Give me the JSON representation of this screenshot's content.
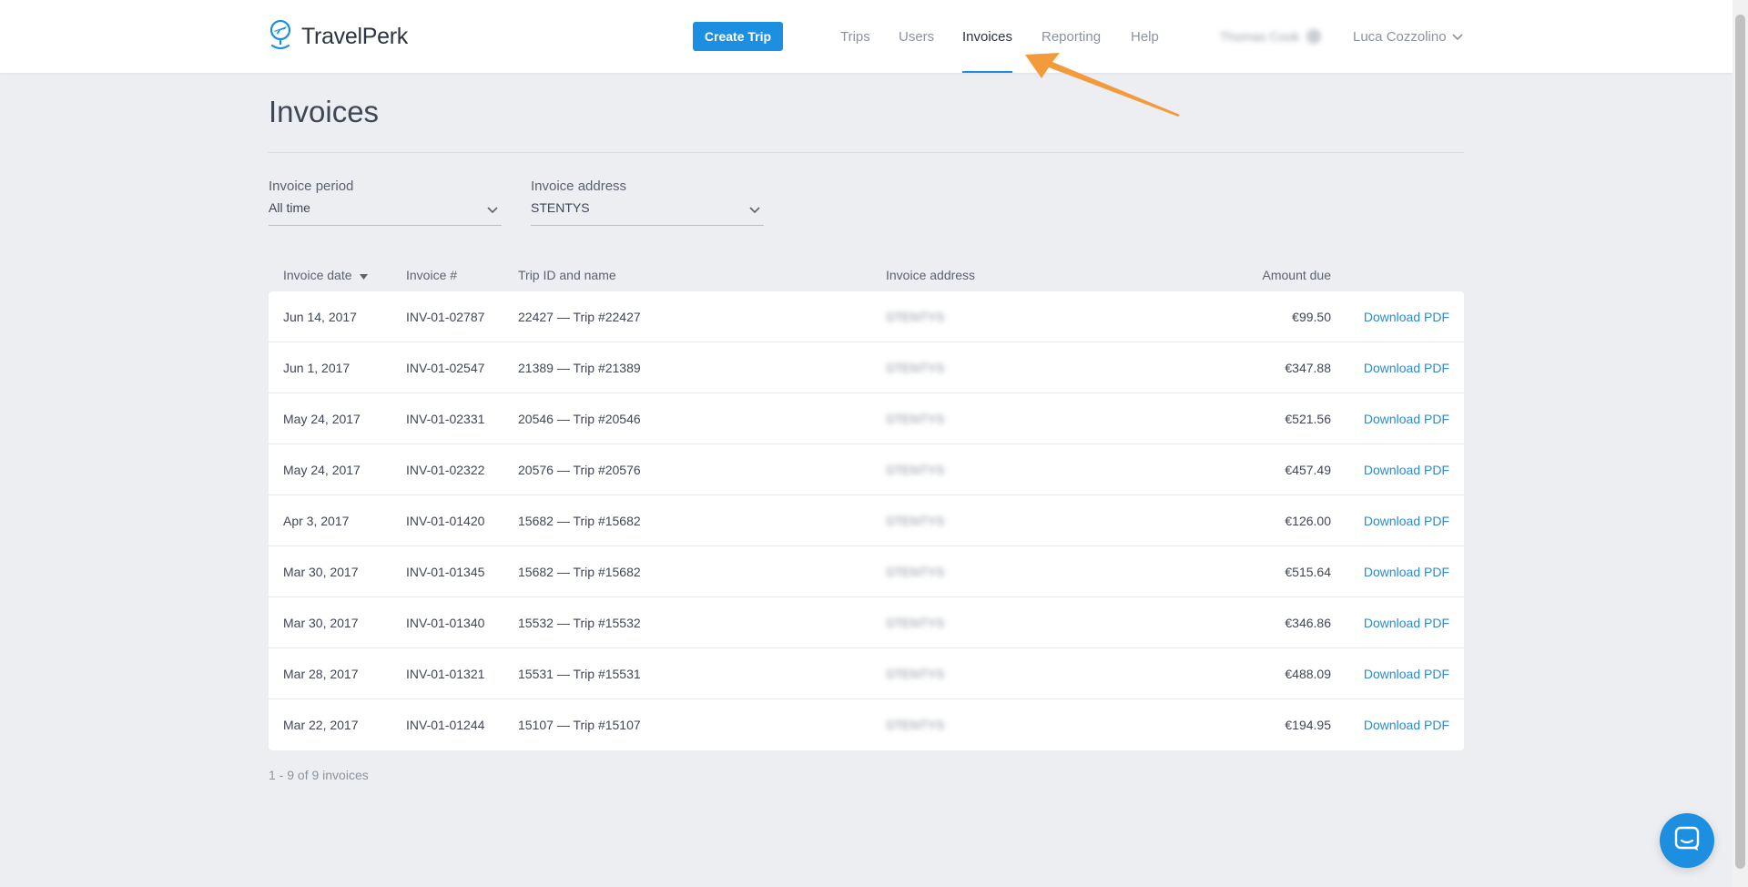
{
  "brand": {
    "name": "TravelPerk",
    "accent": "#1d8fe0"
  },
  "header": {
    "create_trip": "Create Trip",
    "nav": [
      {
        "label": "Trips",
        "active": false
      },
      {
        "label": "Users",
        "active": false
      },
      {
        "label": "Invoices",
        "active": true
      },
      {
        "label": "Reporting",
        "active": false
      },
      {
        "label": "Help",
        "active": false
      }
    ],
    "company_name": "Thomas Cook",
    "user_name": "Luca Cozzolino"
  },
  "page": {
    "title": "Invoices"
  },
  "filters": {
    "period": {
      "label": "Invoice period",
      "value": "All time"
    },
    "address": {
      "label": "Invoice address",
      "value": "STENTYS"
    }
  },
  "table": {
    "headers": {
      "date": "Invoice date",
      "number": "Invoice #",
      "trip": "Trip ID and name",
      "address": "Invoice address",
      "amount": "Amount due"
    },
    "rows": [
      {
        "date": "Jun 14, 2017",
        "number": "INV-01-02787",
        "trip": "22427 — Trip #22427",
        "address": "STENTYS",
        "amount": "€99.50",
        "action": "Download PDF"
      },
      {
        "date": "Jun 1, 2017",
        "number": "INV-01-02547",
        "trip": "21389 — Trip #21389",
        "address": "STENTYS",
        "amount": "€347.88",
        "action": "Download PDF"
      },
      {
        "date": "May 24, 2017",
        "number": "INV-01-02331",
        "trip": "20546 — Trip #20546",
        "address": "STENTYS",
        "amount": "€521.56",
        "action": "Download PDF"
      },
      {
        "date": "May 24, 2017",
        "number": "INV-01-02322",
        "trip": "20576 — Trip #20576",
        "address": "STENTYS",
        "amount": "€457.49",
        "action": "Download PDF"
      },
      {
        "date": "Apr 3, 2017",
        "number": "INV-01-01420",
        "trip": "15682 — Trip #15682",
        "address": "STENTYS",
        "amount": "€126.00",
        "action": "Download PDF"
      },
      {
        "date": "Mar 30, 2017",
        "number": "INV-01-01345",
        "trip": "15682 — Trip #15682",
        "address": "STENTYS",
        "amount": "€515.64",
        "action": "Download PDF"
      },
      {
        "date": "Mar 30, 2017",
        "number": "INV-01-01340",
        "trip": "15532 — Trip #15532",
        "address": "STENTYS",
        "amount": "€346.86",
        "action": "Download PDF"
      },
      {
        "date": "Mar 28, 2017",
        "number": "INV-01-01321",
        "trip": "15531 — Trip #15531",
        "address": "STENTYS",
        "amount": "€488.09",
        "action": "Download PDF"
      },
      {
        "date": "Mar 22, 2017",
        "number": "INV-01-01244",
        "trip": "15107 — Trip #15107",
        "address": "STENTYS",
        "amount": "€194.95",
        "action": "Download PDF"
      }
    ]
  },
  "pagination": {
    "summary": "1 - 9 of 9 invoices"
  },
  "icons": {
    "logo": "plane-globe-icon",
    "sort": "sort-desc-icon",
    "dropdown": "chevron-down-icon",
    "chat": "chat-bubble-icon"
  },
  "annotation": {
    "color": "#f39a3c"
  }
}
